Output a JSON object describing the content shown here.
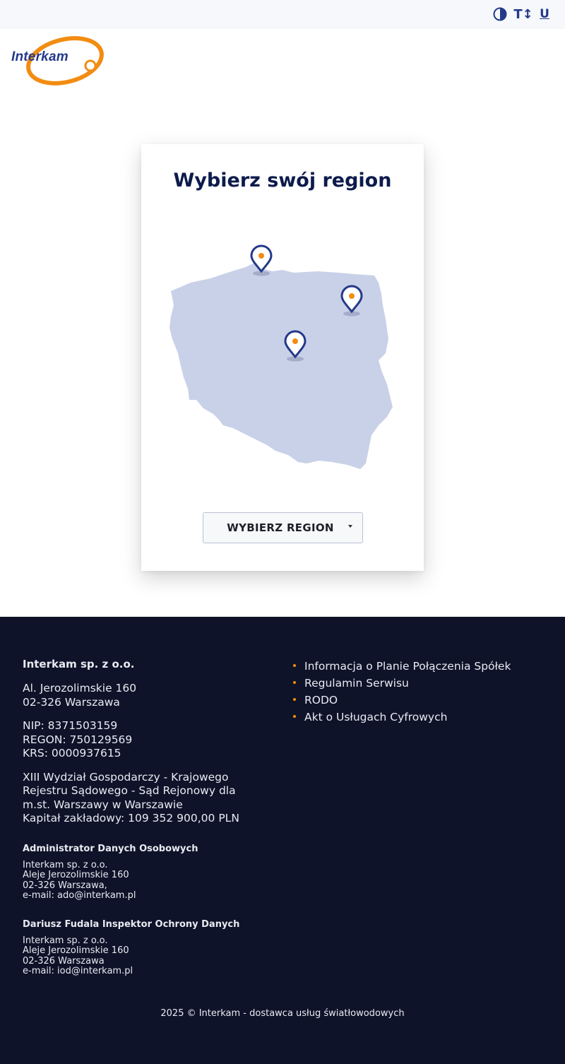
{
  "a11y": {
    "contrast_icon": "contrast-icon",
    "text_size_label": "T↕",
    "underline_label": "U"
  },
  "logo": {
    "text": "Interkam",
    "colors": {
      "ring": "#f28c12",
      "text": "#24398a"
    }
  },
  "card": {
    "title": "Wybierz swój region",
    "select_label": "WYBIERZ REGION"
  },
  "map": {
    "fill": "#c9d1e8",
    "pin_color": "#24398a",
    "pin_dot": "#f28c12",
    "pins": [
      "pin-north",
      "pin-northeast",
      "pin-center"
    ]
  },
  "footer": {
    "company": "Interkam sp. z o.o.",
    "address": [
      "Al. Jerozolimskie 160",
      "02-326 Warszawa"
    ],
    "ids": [
      "NIP: 8371503159",
      "REGON: 750129569",
      "KRS: 0000937615"
    ],
    "court": [
      "XIII Wydział Gospodarczy - Krajowego",
      "Rejestru Sądowego - Sąd Rejonowy dla",
      "m.st. Warszawy w Warszawie",
      "Kapitał zakładowy: 109 352 900,00 PLN"
    ],
    "admin_heading": "Administrator Danych Osobowych",
    "admin_lines": [
      "Interkam sp. z o.o.",
      "Aleje Jerozolimskie 160",
      "02-326 Warszawa,",
      "e-mail: ado@interkam.pl"
    ],
    "iod_heading": "Dariusz Fudala Inspektor Ochrony Danych",
    "iod_lines": [
      "Interkam sp. z o.o.",
      "Aleje Jerozolimskie 160",
      "02-326 Warszawa",
      "e-mail: iod@interkam.pl"
    ],
    "links": [
      "Informacja o Planie Połączenia Spółek",
      "Regulamin Serwisu",
      "RODO",
      "Akt o Usługach Cyfrowych"
    ],
    "copyright": "2025 © Interkam - dostawca usług światłowodowych"
  }
}
